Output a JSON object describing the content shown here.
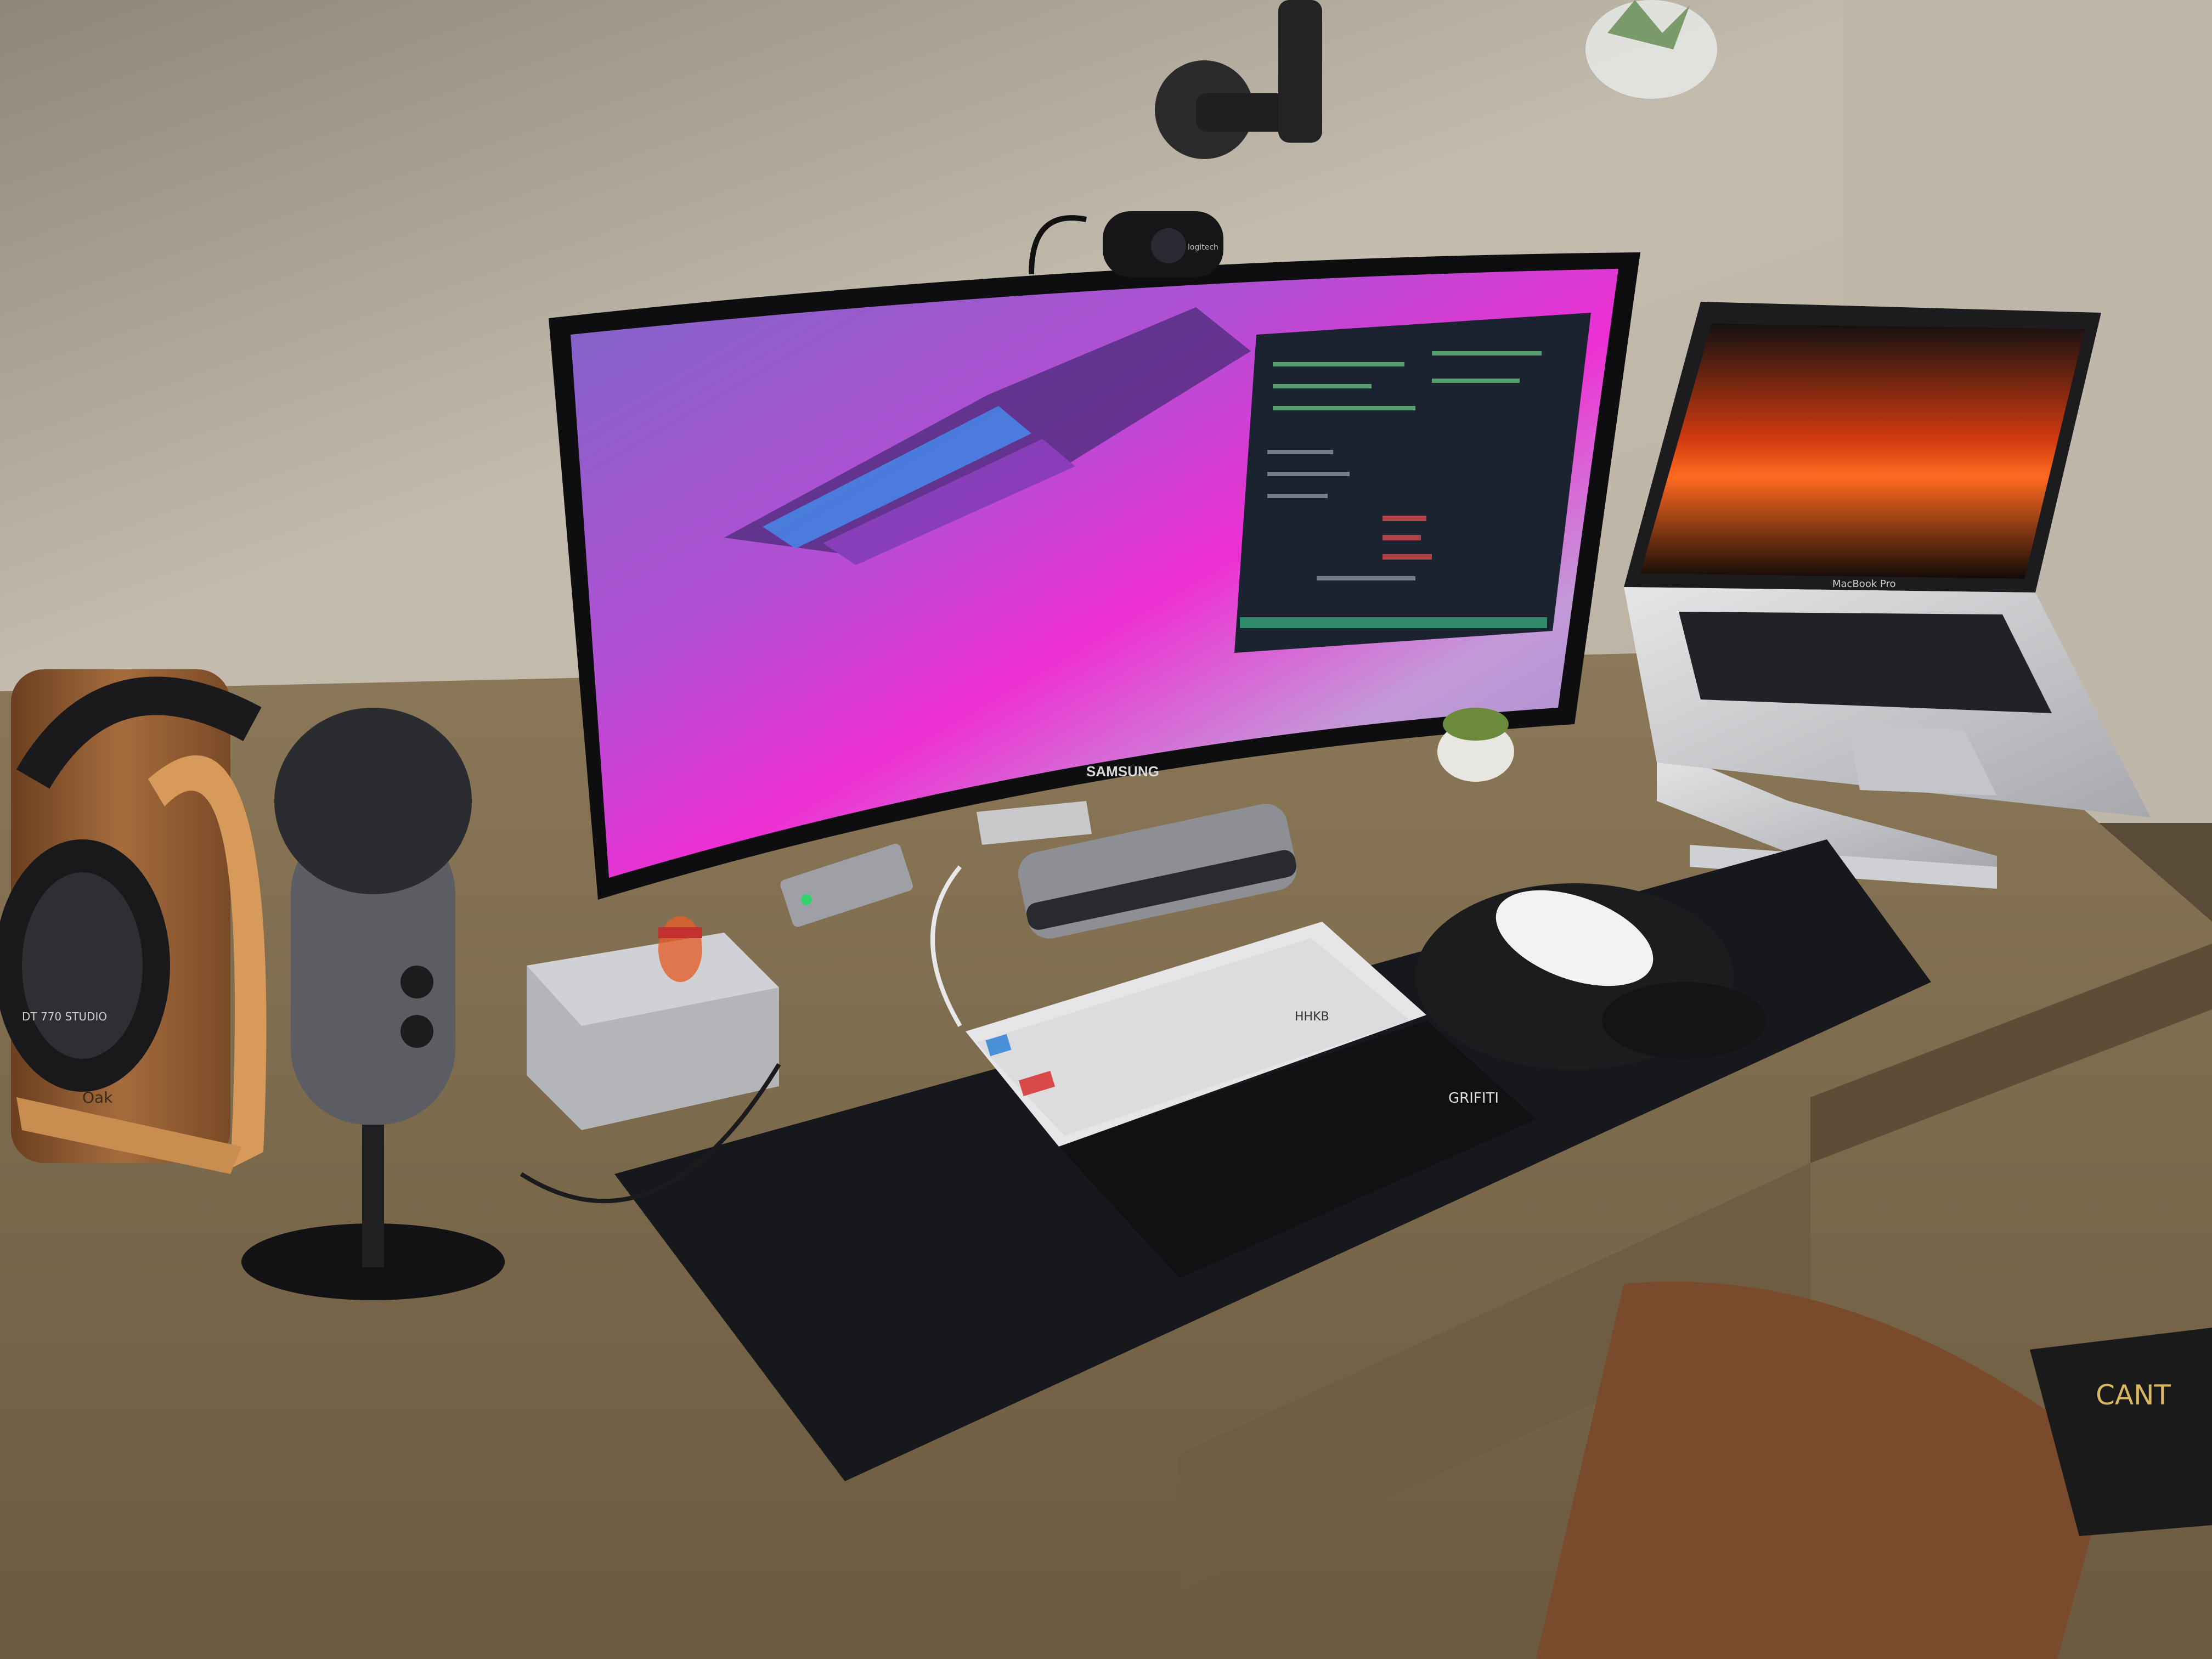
{
  "labels": {
    "monitor_brand": "SAMSUNG",
    "webcam_brand": "logitech",
    "wristrest_brand": "GRIFITI",
    "keyboard_brand": "HHKB",
    "headphone_brand": "DT 770 STUDIO",
    "laptop_text": "MacBook Pro",
    "stand_text": "Oak",
    "book_text": "CANT"
  },
  "colors": {
    "wall": "#c9c2b5",
    "desk": "#7d6b4e",
    "mat": "#16171a",
    "screen_pink": "#e22fd6",
    "screen_purple": "#8a63c8",
    "terminal": "#1c2330",
    "sunset": "#e5481a",
    "wood": "#9b6a3c"
  }
}
